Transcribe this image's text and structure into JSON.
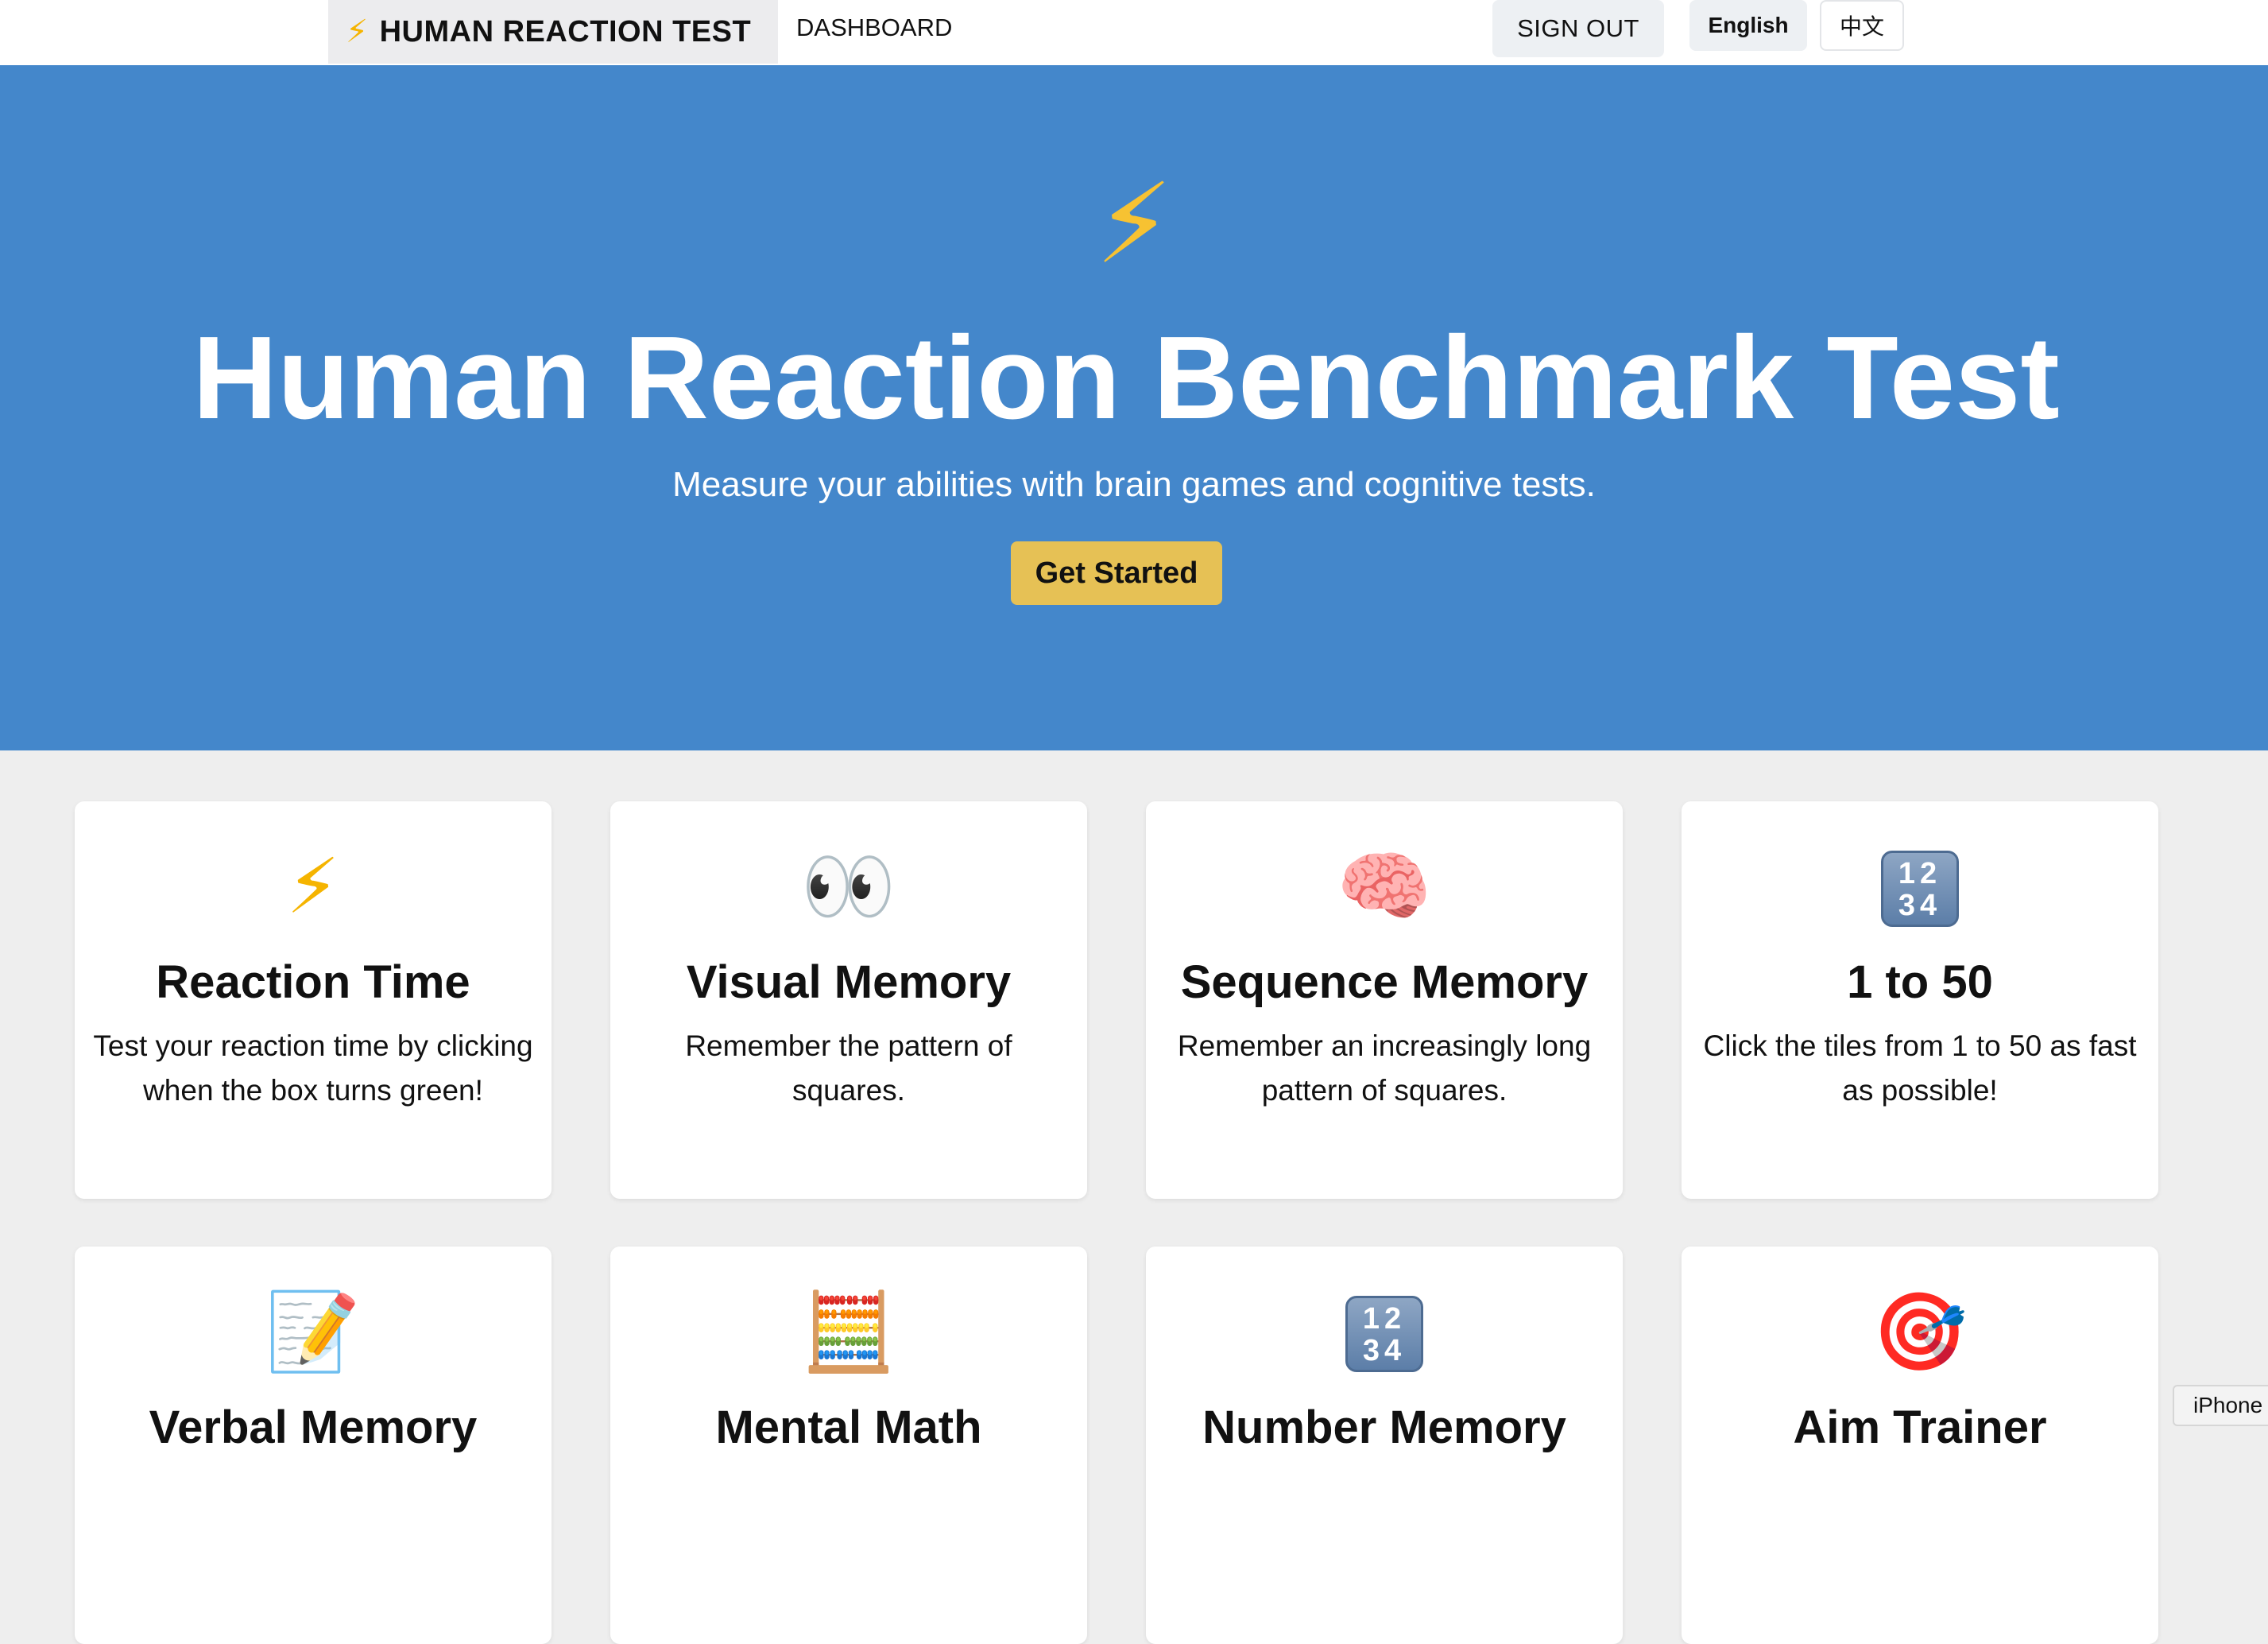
{
  "header": {
    "brand_icon": "⚡",
    "brand": "HUMAN REACTION TEST",
    "dashboard": "DASHBOARD",
    "sign_out": "SIGN OUT",
    "lang_en": "English",
    "lang_zh": "中文"
  },
  "hero": {
    "icon": "⚡",
    "title": "Human Reaction Benchmark Test",
    "subtitle": "Measure your abilities with brain games and cognitive tests.",
    "cta": "Get Started"
  },
  "cards": [
    {
      "icon": "⚡",
      "title": "Reaction Time",
      "desc": "Test your reaction time by clicking when the box turns green!"
    },
    {
      "icon": "👀",
      "title": "Visual Memory",
      "desc": "Remember the pattern of squares."
    },
    {
      "icon": "🧠",
      "title": "Sequence Memory",
      "desc": "Remember an increasingly long pattern of squares."
    },
    {
      "icon": "1234",
      "title": "1 to 50",
      "desc": "Click the tiles from 1 to 50 as fast as possible!"
    },
    {
      "icon": "📝",
      "title": "Verbal Memory",
      "desc": ""
    },
    {
      "icon": "🧮",
      "title": "Mental Math",
      "desc": ""
    },
    {
      "icon": "1234",
      "title": "Number Memory",
      "desc": ""
    },
    {
      "icon": "🎯",
      "title": "Aim Trainer",
      "desc": ""
    }
  ],
  "tooltip": "iPhone"
}
